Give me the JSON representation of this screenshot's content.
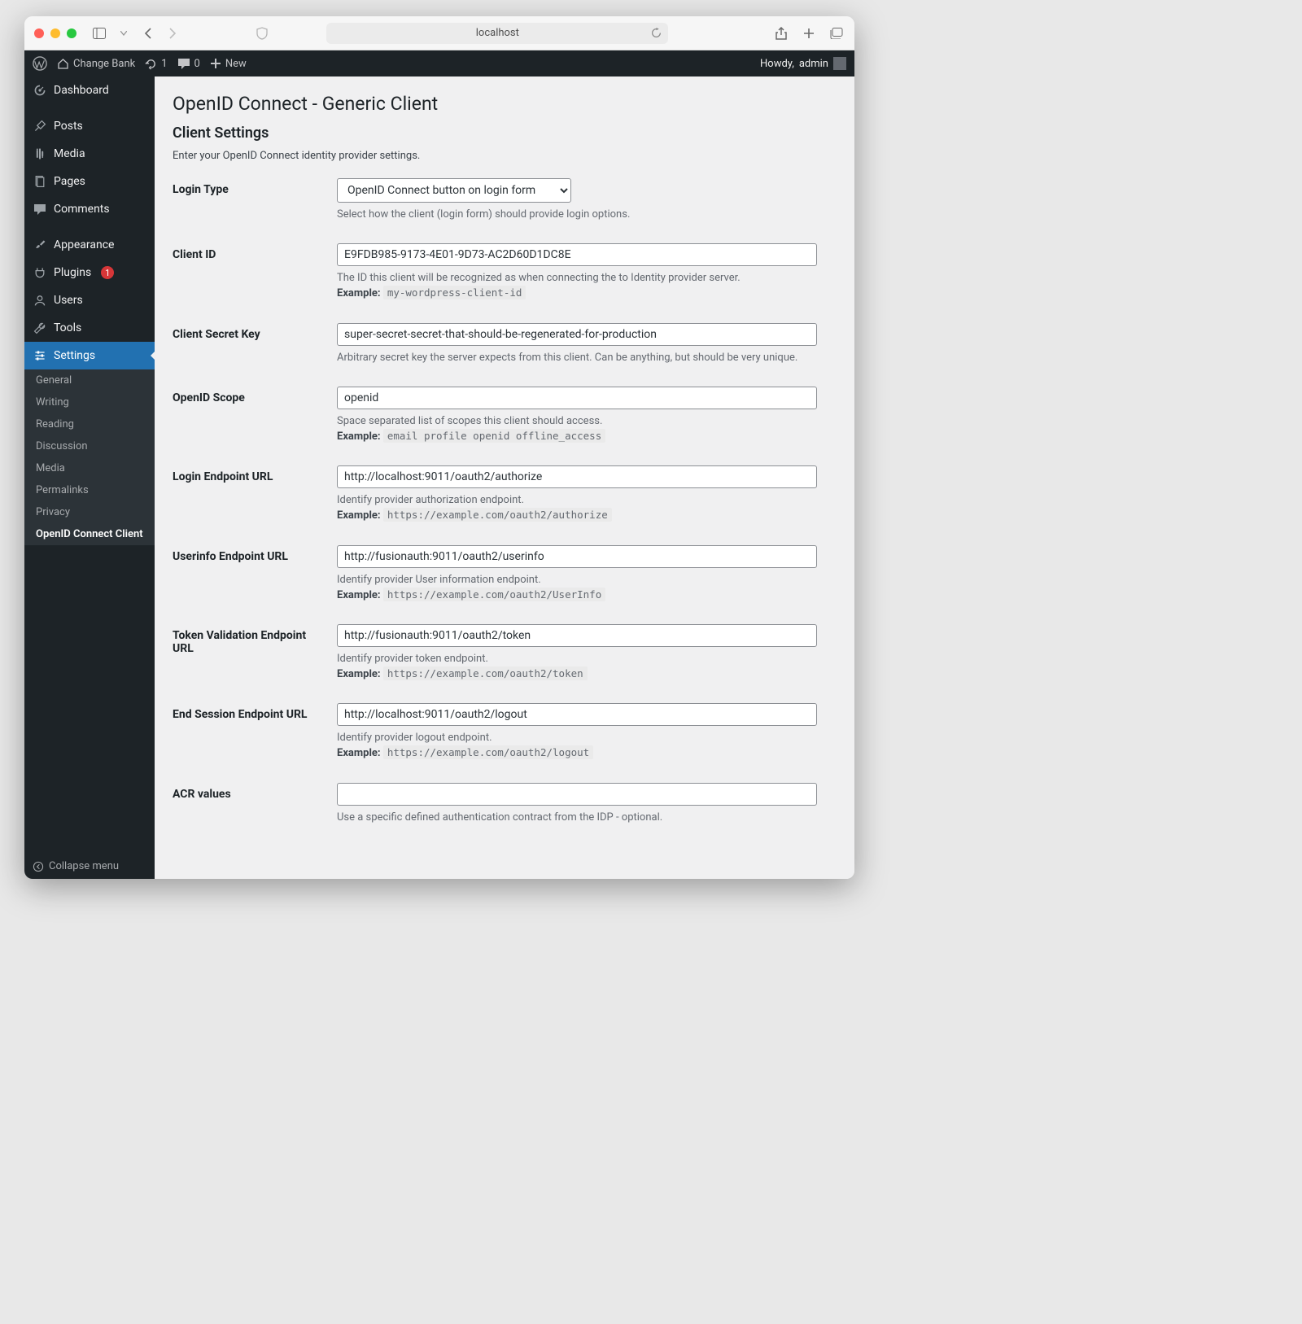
{
  "browser": {
    "url": "localhost"
  },
  "wpbar": {
    "site_name": "Change Bank",
    "updates_count": "1",
    "comments_count": "0",
    "new_label": "New",
    "howdy_prefix": "Howdy,",
    "user": "admin"
  },
  "sidebar": {
    "items": [
      {
        "label": "Dashboard"
      },
      {
        "label": "Posts"
      },
      {
        "label": "Media"
      },
      {
        "label": "Pages"
      },
      {
        "label": "Comments"
      },
      {
        "label": "Appearance"
      },
      {
        "label": "Plugins",
        "badge": "1"
      },
      {
        "label": "Users"
      },
      {
        "label": "Tools"
      },
      {
        "label": "Settings"
      }
    ],
    "submenu": [
      {
        "label": "General"
      },
      {
        "label": "Writing"
      },
      {
        "label": "Reading"
      },
      {
        "label": "Discussion"
      },
      {
        "label": "Media"
      },
      {
        "label": "Permalinks"
      },
      {
        "label": "Privacy"
      },
      {
        "label": "OpenID Connect Client"
      }
    ],
    "collapse_label": "Collapse menu"
  },
  "page": {
    "title": "OpenID Connect - Generic Client",
    "section_title": "Client Settings",
    "section_desc": "Enter your OpenID Connect identity provider settings."
  },
  "fields": {
    "login_type": {
      "label": "Login Type",
      "value": "OpenID Connect button on login form",
      "help": "Select how the client (login form) should provide login options."
    },
    "client_id": {
      "label": "Client ID",
      "value": "E9FDB985-9173-4E01-9D73-AC2D60D1DC8E",
      "help": "The ID this client will be recognized as when connecting the to Identity provider server.",
      "example_label": "Example:",
      "example": "my-wordpress-client-id"
    },
    "client_secret": {
      "label": "Client Secret Key",
      "value": "super-secret-secret-that-should-be-regenerated-for-production",
      "help": "Arbitrary secret key the server expects from this client. Can be anything, but should be very unique."
    },
    "scope": {
      "label": "OpenID Scope",
      "value": "openid",
      "help": "Space separated list of scopes this client should access.",
      "example_label": "Example:",
      "example": "email profile openid offline_access"
    },
    "login_ep": {
      "label": "Login Endpoint URL",
      "value": "http://localhost:9011/oauth2/authorize",
      "help": "Identify provider authorization endpoint.",
      "example_label": "Example:",
      "example": "https://example.com/oauth2/authorize"
    },
    "userinfo_ep": {
      "label": "Userinfo Endpoint URL",
      "value": "http://fusionauth:9011/oauth2/userinfo",
      "help": "Identify provider User information endpoint.",
      "example_label": "Example:",
      "example": "https://example.com/oauth2/UserInfo"
    },
    "token_ep": {
      "label": "Token Validation Endpoint URL",
      "value": "http://fusionauth:9011/oauth2/token",
      "help": "Identify provider token endpoint.",
      "example_label": "Example:",
      "example": "https://example.com/oauth2/token"
    },
    "end_session_ep": {
      "label": "End Session Endpoint URL",
      "value": "http://localhost:9011/oauth2/logout",
      "help": "Identify provider logout endpoint.",
      "example_label": "Example:",
      "example": "https://example.com/oauth2/logout"
    },
    "acr": {
      "label": "ACR values",
      "value": "",
      "help": "Use a specific defined authentication contract from the IDP - optional."
    }
  }
}
